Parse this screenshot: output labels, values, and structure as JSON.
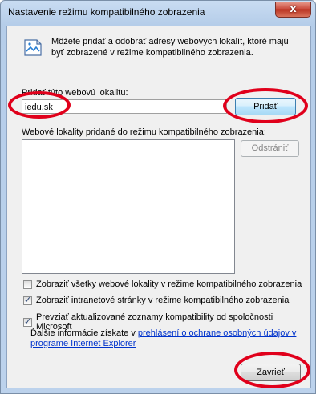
{
  "window": {
    "title": "Nastavenie režimu kompatibilného zobrazenia",
    "close_glyph": "x"
  },
  "info": {
    "text": "Môžete pridať a odobrať adresy webových lokalít, ktoré majú byť zobrazené v režime kompatibilného zobrazenia."
  },
  "add": {
    "label": "Pridať túto webovú lokalitu:",
    "value": "iedu.sk",
    "button": "Pridať"
  },
  "list": {
    "label": "Webové lokality pridané do režimu kompatibilného zobrazenia:",
    "remove_button": "Odstrániť",
    "items": []
  },
  "options": [
    {
      "label": "Zobraziť všetky webové lokality v režime kompatibilného zobrazenia",
      "checked": false
    },
    {
      "label": "Zobraziť intranetové stránky v režime kompatibilného zobrazenia",
      "checked": true
    },
    {
      "label": "Prevziať aktualizované zoznamy kompatibility od spoločnosti Microsoft",
      "checked": true
    }
  ],
  "more_info": {
    "prefix": "Ďalšie informácie získate v ",
    "link": "prehlásení o ochrane osobných údajov v programe Internet Explorer"
  },
  "close_button": "Zavrieť",
  "annotation_color": "#e0001b"
}
